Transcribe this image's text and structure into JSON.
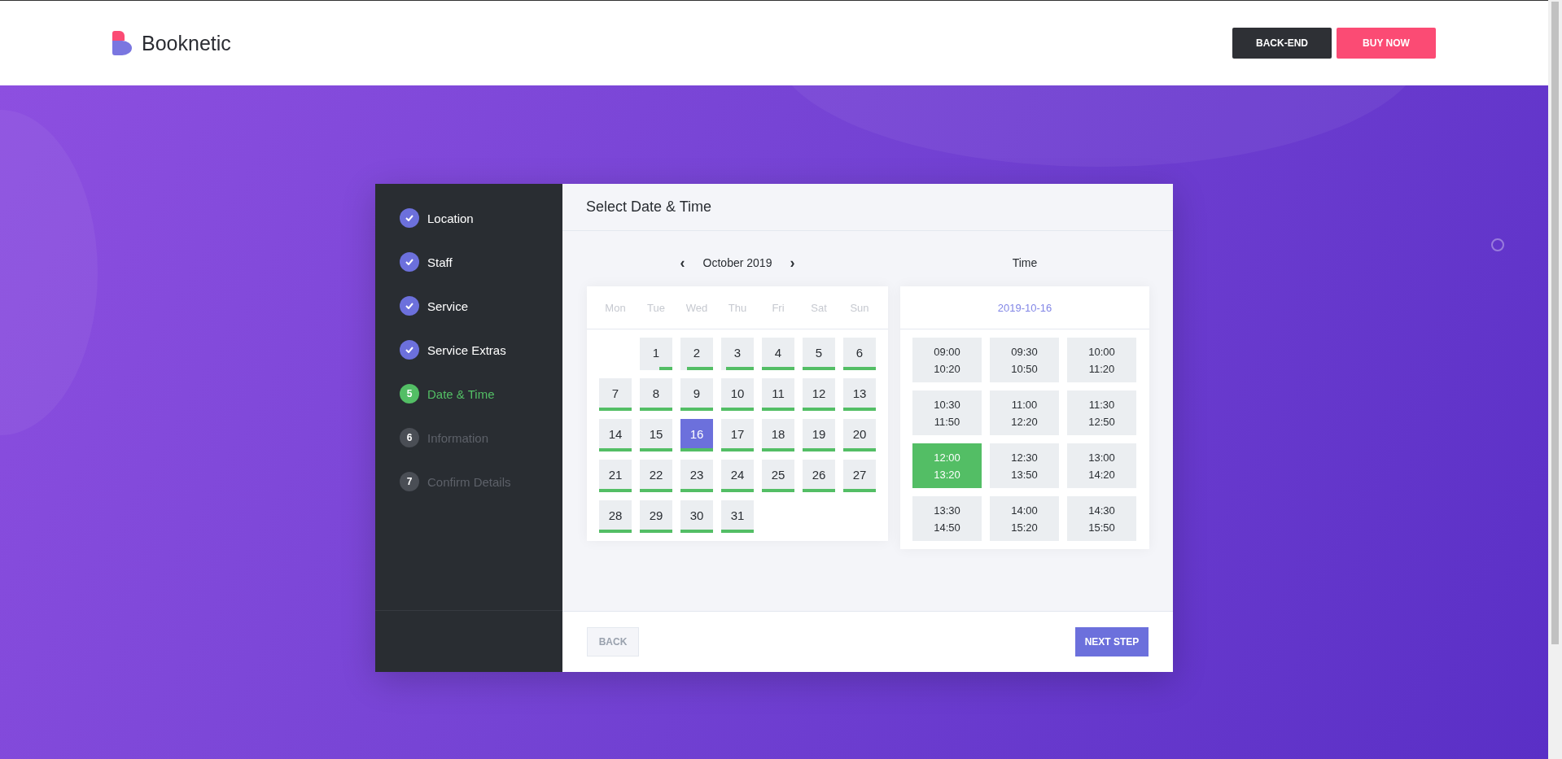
{
  "header": {
    "brand": "Booknetic",
    "buttons": [
      {
        "label": "BACK-END",
        "kind": "dark"
      },
      {
        "label": "BUY NOW",
        "kind": "accent"
      }
    ]
  },
  "steps": [
    {
      "label": "Location",
      "kind": "done"
    },
    {
      "label": "Staff",
      "kind": "done"
    },
    {
      "label": "Service",
      "kind": "done"
    },
    {
      "label": "Service Extras",
      "kind": "done"
    },
    {
      "label": "Date & Time",
      "kind": "current",
      "number": "5"
    },
    {
      "label": "Information",
      "kind": "pending",
      "number": "6"
    },
    {
      "label": "Confirm Details",
      "kind": "pending",
      "number": "7"
    }
  ],
  "panel": {
    "title": "Select Date & Time",
    "calendar": {
      "prev": "‹",
      "month": "October 2019",
      "next": "›",
      "weekdays": [
        "Mon",
        "Tue",
        "Wed",
        "Thu",
        "Fri",
        "Sat",
        "Sun"
      ],
      "days": [
        {
          "day": "1",
          "selected": false,
          "level": 0.4
        },
        {
          "day": "2",
          "selected": false,
          "level": 0.8
        },
        {
          "day": "3",
          "selected": false,
          "level": 0.85
        },
        {
          "day": "4",
          "selected": false,
          "level": 1
        },
        {
          "day": "5",
          "selected": false,
          "level": 1
        },
        {
          "day": "6",
          "selected": false,
          "level": 1
        },
        {
          "day": "7",
          "selected": false,
          "level": 1
        },
        {
          "day": "8",
          "selected": false,
          "level": 1
        },
        {
          "day": "9",
          "selected": false,
          "level": 1
        },
        {
          "day": "10",
          "selected": false,
          "level": 1
        },
        {
          "day": "11",
          "selected": false,
          "level": 1
        },
        {
          "day": "12",
          "selected": false,
          "level": 1
        },
        {
          "day": "13",
          "selected": false,
          "level": 1
        },
        {
          "day": "14",
          "selected": false,
          "level": 1
        },
        {
          "day": "15",
          "selected": false,
          "level": 1
        },
        {
          "day": "16",
          "selected": true,
          "level": 1
        },
        {
          "day": "17",
          "selected": false,
          "level": 1
        },
        {
          "day": "18",
          "selected": false,
          "level": 1
        },
        {
          "day": "19",
          "selected": false,
          "level": 1
        },
        {
          "day": "20",
          "selected": false,
          "level": 1
        },
        {
          "day": "21",
          "selected": false,
          "level": 1
        },
        {
          "day": "22",
          "selected": false,
          "level": 1
        },
        {
          "day": "23",
          "selected": false,
          "level": 1
        },
        {
          "day": "24",
          "selected": false,
          "level": 1
        },
        {
          "day": "25",
          "selected": false,
          "level": 1
        },
        {
          "day": "26",
          "selected": false,
          "level": 1
        },
        {
          "day": "27",
          "selected": false,
          "level": 1
        },
        {
          "day": "28",
          "selected": false,
          "level": 1
        },
        {
          "day": "29",
          "selected": false,
          "level": 1
        },
        {
          "day": "30",
          "selected": false,
          "level": 1
        },
        {
          "day": "31",
          "selected": false,
          "level": 1
        }
      ]
    },
    "time": {
      "heading": "Time",
      "date": "2019-10-16",
      "slots": [
        {
          "start": "09:00",
          "end": "10:20",
          "selected": false
        },
        {
          "start": "09:30",
          "end": "10:50",
          "selected": false
        },
        {
          "start": "10:00",
          "end": "11:20",
          "selected": false
        },
        {
          "start": "10:30",
          "end": "11:50",
          "selected": false
        },
        {
          "start": "11:00",
          "end": "12:20",
          "selected": false
        },
        {
          "start": "11:30",
          "end": "12:50",
          "selected": false
        },
        {
          "start": "12:00",
          "end": "13:20",
          "selected": true
        },
        {
          "start": "12:30",
          "end": "13:50",
          "selected": false
        },
        {
          "start": "13:00",
          "end": "14:20",
          "selected": false
        },
        {
          "start": "13:30",
          "end": "14:50",
          "selected": false
        },
        {
          "start": "14:00",
          "end": "15:20",
          "selected": false
        },
        {
          "start": "14:30",
          "end": "15:50",
          "selected": false
        }
      ]
    },
    "footer": {
      "back": "BACK",
      "next": "NEXT STEP"
    }
  }
}
